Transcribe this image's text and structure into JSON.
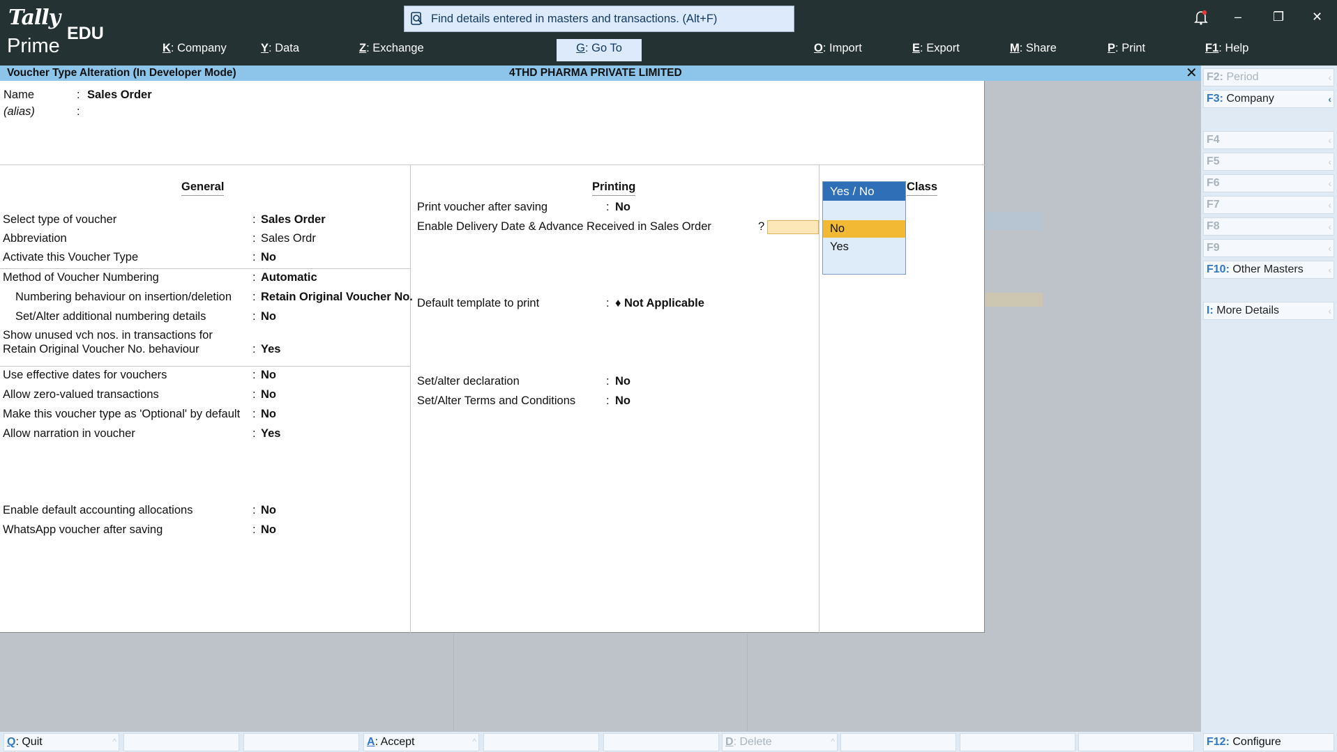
{
  "app": {
    "logo_tally": "Tally",
    "logo_prime": "Prime",
    "edition": "EDU"
  },
  "search": {
    "text": "Find details entered in masters and transactions. (Alt+F)"
  },
  "menu": [
    {
      "key": "K",
      "label": "Company"
    },
    {
      "key": "Y",
      "label": "Data"
    },
    {
      "key": "Z",
      "label": "Exchange"
    },
    {
      "key": "G",
      "label": "Go To"
    },
    {
      "key": "O",
      "label": "Import"
    },
    {
      "key": "E",
      "label": "Export"
    },
    {
      "key": "M",
      "label": "Share"
    },
    {
      "key": "P",
      "label": "Print"
    },
    {
      "key": "F1",
      "label": "Help"
    }
  ],
  "window": {
    "bell": "bell-icon",
    "minimize": "–",
    "restore": "❐",
    "close": "✕"
  },
  "screen_title": "Voucher Type Alteration (In Developer Mode)",
  "company": "4THD PHARMA PRIVATE LIMITED",
  "header": {
    "name_label": "Name",
    "name_value": "Sales Order",
    "alias_label": "(alias)",
    "sep": ":"
  },
  "general": {
    "heading": "General",
    "rows": [
      {
        "label": "Select type of voucher",
        "value": "Sales Order"
      },
      {
        "label": "Abbreviation",
        "value": "Sales Ordr"
      },
      {
        "label": "Activate this Voucher Type",
        "value": "No"
      },
      {
        "label": "Method of Voucher Numbering",
        "value": "Automatic"
      },
      {
        "label": "Numbering behaviour on insertion/deletion",
        "value": "Retain Original Voucher No."
      },
      {
        "label": "Set/Alter additional numbering details",
        "value": "No"
      },
      {
        "label": "Show unused vch nos. in transactions for",
        "label2": "Retain Original Voucher No. behaviour",
        "value": "Yes"
      },
      {
        "label": "Use effective dates for vouchers",
        "value": "No"
      },
      {
        "label": "Allow zero-valued transactions",
        "value": "No"
      },
      {
        "label": "Make this voucher type as 'Optional' by default",
        "value": "No"
      },
      {
        "label": "Allow narration in voucher",
        "value": "Yes"
      },
      {
        "label": "Enable default accounting allocations",
        "value": "No"
      },
      {
        "label": "WhatsApp voucher after saving",
        "value": "No"
      }
    ]
  },
  "printing": {
    "heading": "Printing",
    "rows": [
      {
        "label": "Print voucher after saving",
        "value": "No"
      },
      {
        "label": "Enable Delivery Date & Advance Received in Sales Order",
        "value": "?"
      },
      {
        "label": "Default template to print",
        "value": "♦ Not Applicable"
      },
      {
        "label": "Set/alter declaration",
        "value": "No"
      },
      {
        "label": "Set/Alter Terms and Conditions",
        "value": "No"
      }
    ]
  },
  "class_heading": "Class",
  "dropdown": {
    "title": "Yes / No",
    "options": [
      "No",
      "Yes"
    ],
    "selected": "No"
  },
  "right_buttons": [
    {
      "key": "F2:",
      "label": "Period",
      "enabled": false
    },
    {
      "key": "F3:",
      "label": "Company",
      "enabled": true
    },
    {
      "key": "F4",
      "label": "",
      "enabled": false
    },
    {
      "key": "F5",
      "label": "",
      "enabled": false
    },
    {
      "key": "F6",
      "label": "",
      "enabled": false
    },
    {
      "key": "F7",
      "label": "",
      "enabled": false
    },
    {
      "key": "F8",
      "label": "",
      "enabled": false
    },
    {
      "key": "F9",
      "label": "",
      "enabled": false
    },
    {
      "key": "F10:",
      "label": "Other Masters",
      "enabled": true
    },
    {
      "key": "I:",
      "label": "More Details",
      "enabled": true
    },
    {
      "key": "F12:",
      "label": "Configure",
      "enabled": true
    }
  ],
  "bottom_buttons": [
    {
      "key": "Q",
      "label": "Quit",
      "enabled": true
    },
    {
      "key": "A",
      "label": "Accept",
      "enabled": true
    },
    {
      "key": "D",
      "label": "Delete",
      "enabled": false
    }
  ]
}
